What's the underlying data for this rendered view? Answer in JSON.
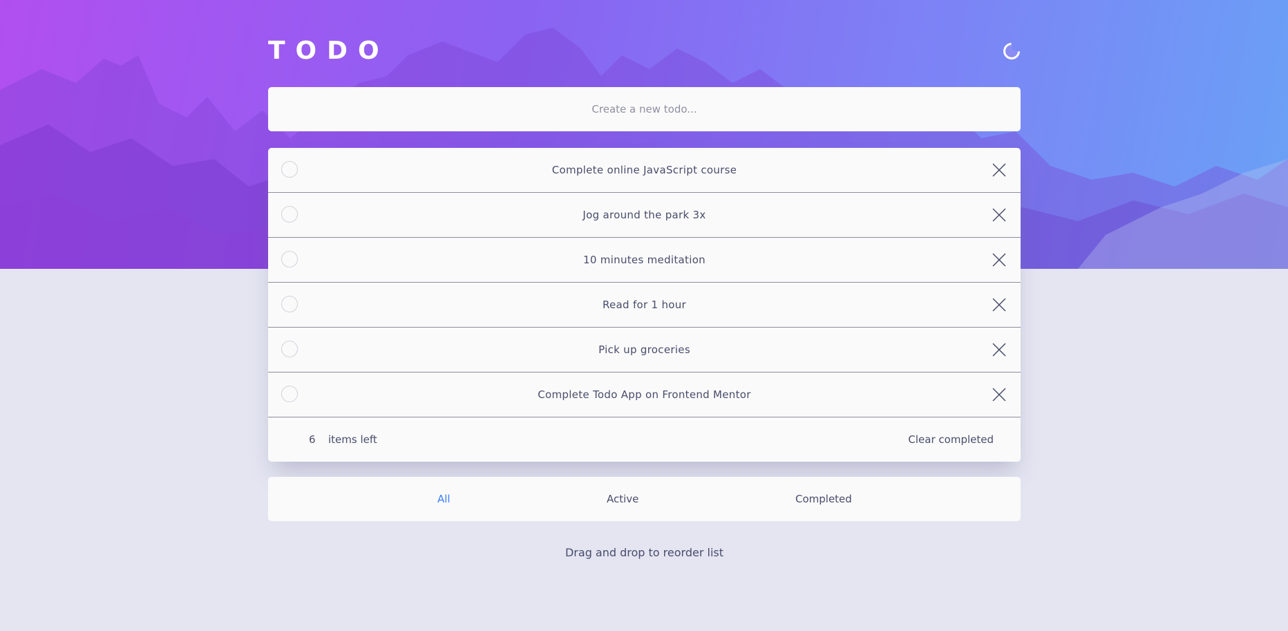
{
  "header": {
    "title": "TODO",
    "theme_icon": "moon-icon"
  },
  "new_todo": {
    "placeholder": "Create a new todo...",
    "value": ""
  },
  "todos": [
    {
      "text": "Complete online JavaScript course",
      "completed": false
    },
    {
      "text": "Jog around the park 3x",
      "completed": false
    },
    {
      "text": "10 minutes meditation",
      "completed": false
    },
    {
      "text": "Read for 1 hour",
      "completed": false
    },
    {
      "text": "Pick up groceries",
      "completed": false
    },
    {
      "text": "Complete Todo App on Frontend Mentor",
      "completed": false
    }
  ],
  "footer": {
    "count": "6",
    "items_left_label": "items left",
    "clear_completed_label": "Clear completed"
  },
  "filters": {
    "all": "All",
    "active": "Active",
    "completed": "Completed",
    "selected": "All"
  },
  "hint": "Drag and drop to reorder list",
  "colors": {
    "accent": "#3a7cfd",
    "text": "#494c6b",
    "page_background": "#e4e5f1",
    "card_background": "#fafafa",
    "hero_gradient_start": "#b14ff0",
    "hero_gradient_end": "#6aa1f6"
  }
}
